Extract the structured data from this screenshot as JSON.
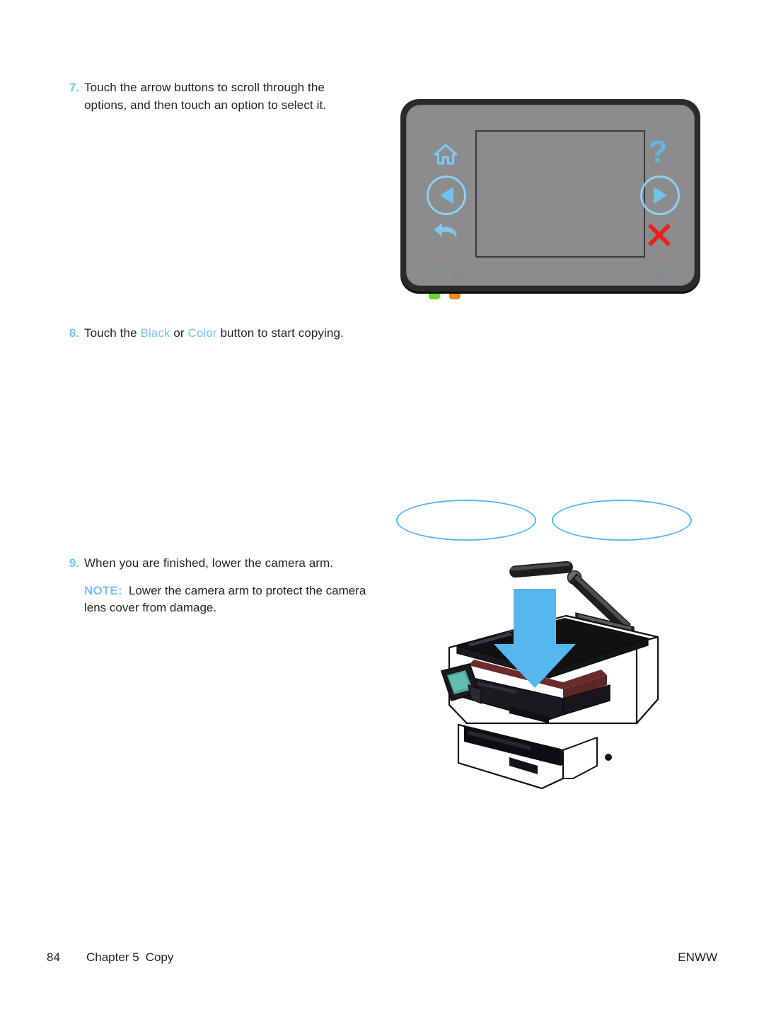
{
  "colors": {
    "accent_blue": "#6ec6f0",
    "arrow_blue": "#56b7ef",
    "cancel_red": "#e8231f",
    "panel_gray": "#8c8c8c",
    "bezel_dark": "#2b2b2b",
    "led_ready_green": "#5ee02a",
    "led_attention_orange": "#f08a18"
  },
  "steps": [
    {
      "number": "7.",
      "text": "Touch the arrow buttons to scroll through the options, and then touch an option to select it."
    },
    {
      "number": "8.",
      "text_before": "Touch the ",
      "accent_1": "Black",
      "text_middle": " or ",
      "accent_2": "Color",
      "text_after": " button to start copying."
    },
    {
      "number": "9.",
      "text": "When you are finished, lower the camera arm.",
      "note_label": "NOTE:",
      "note_text": "Lower the camera arm to protect the camera lens cover from damage."
    }
  ],
  "control_panel": {
    "icons": {
      "home": "home-icon",
      "help": "?",
      "back": "back-arrow-icon",
      "cancel": "cancel-x-icon",
      "left_arrow": "left-arrow-button",
      "right_arrow": "right-arrow-button",
      "ready": "power-ready-icon",
      "attention": "warning-triangle-icon",
      "wireless": "wireless-icon"
    }
  },
  "printer_figure": {
    "caption": "printer with camera arm raised and blue down arrow indicating to lower the arm"
  },
  "footer": {
    "page_number": "84",
    "chapter": "Chapter 5",
    "section": "Copy",
    "locale": "ENWW"
  }
}
